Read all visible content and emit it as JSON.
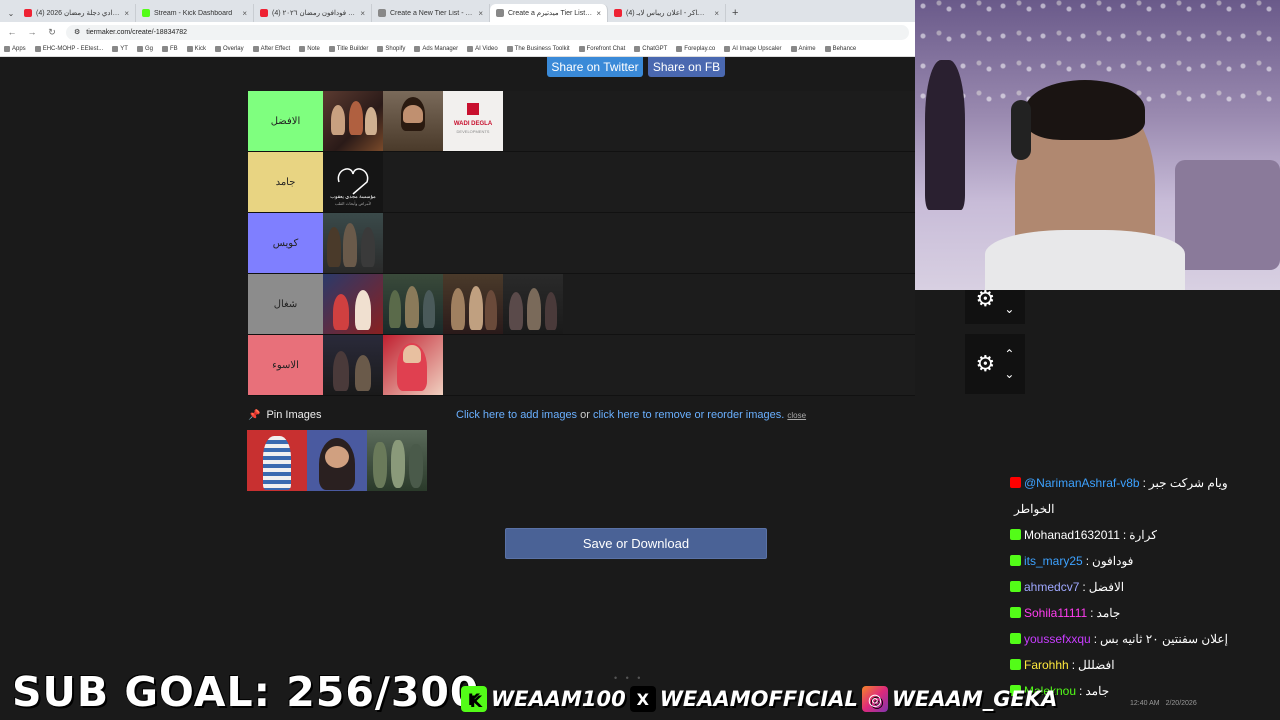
{
  "browser": {
    "tabs": [
      {
        "title": "(4) إعلان وادي دجلة رمضان 2026",
        "favicon_color": "#e23"
      },
      {
        "title": "Stream - Kick Dashboard",
        "favicon_color": "#53fc18"
      },
      {
        "title": "(4) اعلان فودافون رمضان ٢٠٢٦ -",
        "favicon_color": "#e23"
      },
      {
        "title": "Create a New Tier List - TierMa",
        "favicon_color": "#888"
      },
      {
        "title": "Create a ميدتيرم Tier List - Tier",
        "favicon_color": "#888"
      },
      {
        "title": "(4) هيثم شاكر - اعلان ريباس لايـ",
        "favicon_color": "#e23"
      }
    ],
    "active_tab": 4,
    "tab_close": "×",
    "new_tab": "+",
    "url": "tiermaker.com/create/-18834782",
    "bookmarks": [
      "Apps",
      "EHC-MOHP - EEtest...",
      "YT",
      "Gg",
      "FB",
      "Kick",
      "Overlay",
      "After Effect",
      "Note",
      "Title Builder",
      "Shopify",
      "Ads Manager",
      "AI Video",
      "The Business Toolkit",
      "Forefront Chat",
      "ChatGPT",
      "Foreplay.co",
      "AI Image Upscaler",
      "Anime",
      "Behance"
    ]
  },
  "page": {
    "share_twitter": "Share on Twitter",
    "share_fb": "Share on FB",
    "tiers": [
      {
        "label": "الافضل",
        "color": "#7fff7f",
        "item_count": 3
      },
      {
        "label": "جامد",
        "color": "#e8d482",
        "item_count": 1
      },
      {
        "label": "كويس",
        "color": "#7f7fff",
        "item_count": 1
      },
      {
        "label": "شغال",
        "color": "#8c8c8c",
        "item_count": 4
      },
      {
        "label": "الاسوء",
        "color": "#e8707a",
        "item_count": 2
      }
    ],
    "wadi_logo_line1": "WADI DEGLA",
    "wadi_logo_line2": "DEVELOPMENTS",
    "magdi_logo_line1": "مؤسسة مجدي يعقوب",
    "magdi_logo_line2": "لأمراض وأبحاث القلب",
    "pin_images_label": "Pin Images",
    "add_images_link": "Click here to add images",
    "or_text": " or ",
    "remove_link": "click here to remove or reorder images.",
    "close_link": "close",
    "save_button": "Save or Download",
    "bottom_dots": "• • •"
  },
  "chat": {
    "messages": [
      {
        "badge": "yt",
        "badge_color": "#ff0000",
        "user": "@NarimanAshraf-v8b",
        "user_color": "#3da2ff",
        "text": "ويام شركت جبر",
        "cont": "الخواطر"
      },
      {
        "badge": "kick",
        "badge_color": "#53fc18",
        "user": "Mohanad1632011",
        "user_color": "#ffffff",
        "text": "كرارة"
      },
      {
        "badge": "kick",
        "badge_color": "#53fc18",
        "user": "its_mary25",
        "user_color": "#3da2ff",
        "text": "فودافون"
      },
      {
        "badge": "kick",
        "badge_color": "#53fc18",
        "user": "ahmedcv7",
        "user_color": "#9fa8ff",
        "text": "الافضل"
      },
      {
        "badge": "kick",
        "badge_color": "#53fc18",
        "user": "Sohila11111",
        "user_color": "#ff3df0",
        "text": "جامد"
      },
      {
        "badge": "kick",
        "badge_color": "#53fc18",
        "user": "youssefxxqu",
        "user_color": "#c83dff",
        "text": "إعلان سفنتين ٢٠ ثانيه بس"
      },
      {
        "badge": "kick",
        "badge_color": "#53fc18",
        "user": "Farohhh",
        "user_color": "#ffe93d",
        "text": "افضللل"
      },
      {
        "badge": "kick",
        "badge_color": "#53fc18",
        "user": "Maleknou",
        "user_color": "#53fc18",
        "text": "جامد"
      }
    ]
  },
  "overlay": {
    "sub_goal": "SUB GOAL: 256/300",
    "kick_handle": "WEAAM100",
    "x_handle": "WEAAMOFFICIAL",
    "ig_handle": "WEAAM_GEKA",
    "kick_icon": "K",
    "x_icon": "X",
    "ig_icon": "◎",
    "clock_time": "12:40 AM",
    "clock_date": "2/20/2026"
  }
}
